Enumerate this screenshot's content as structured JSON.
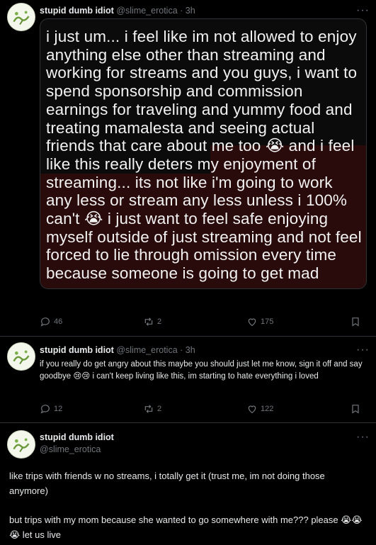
{
  "tweets": [
    {
      "name": "stupid dumb idiot",
      "handle": "@slime_erotica",
      "time": "3h",
      "image_text": "i just um... i feel like im not allowed to enjoy anything else other than streaming and working for streams and you guys, i want to spend sponsorship and commission earnings for traveling and yummy food and treating mamalesta and seeing actual friends that care about me too 😭 and i feel like this really deters my enjoyment of streaming... its not like i'm going to work any less or stream any less unless i 100% can't 😭 i just want to feel safe enjoying myself outside of just streaming and not feel forced to lie through omission every time because someone is going to get mad",
      "replies": "46",
      "reposts": "2",
      "likes": "175"
    },
    {
      "name": "stupid dumb idiot",
      "handle": "@slime_erotica",
      "time": "3h",
      "text": "if you really do get angry about this maybe you should just let me know, sign it off and say goodbye 😢😢 i can't keep living like this, im starting to hate everything i loved",
      "replies": "12",
      "reposts": "2",
      "likes": "122"
    },
    {
      "name": "stupid dumb idiot",
      "handle": "@slime_erotica",
      "paragraph1": "like trips with friends w no streams, i totally get it (trust me, im not doing those anymore)",
      "paragraph2": "but trips with my mom because she wanted to go somewhere with me??? please 😭😭😭 let us live"
    }
  ],
  "separator": "·",
  "colors": {
    "background": "#000000",
    "text": "#e7e9ea",
    "muted": "#71767b",
    "border": "#2f3336"
  },
  "icons": [
    "reply-icon",
    "repost-icon",
    "like-icon",
    "bookmark-icon",
    "more-icon"
  ]
}
